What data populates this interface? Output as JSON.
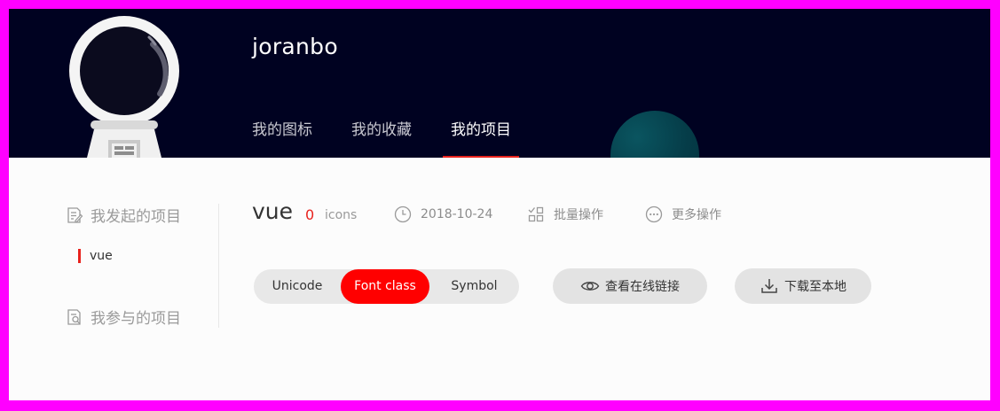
{
  "header": {
    "username": "joranbo",
    "tabs": [
      {
        "label": "我的图标",
        "active": false
      },
      {
        "label": "我的收藏",
        "active": false
      },
      {
        "label": "我的项目",
        "active": true
      }
    ]
  },
  "sidebar": {
    "groups": [
      {
        "label": "我发起的项目",
        "icon": "edit-document-icon"
      },
      {
        "label": "我参与的项目",
        "icon": "document-search-icon"
      }
    ],
    "active_item": "vue"
  },
  "project": {
    "name": "vue",
    "icon_count": "0",
    "icon_unit": "icons",
    "date": "2018-10-24",
    "batch_label": "批量操作",
    "more_label": "更多操作"
  },
  "toolbar": {
    "segments": [
      {
        "label": "Unicode",
        "active": false
      },
      {
        "label": "Font class",
        "active": true
      },
      {
        "label": "Symbol",
        "active": false
      }
    ],
    "view_link_label": "查看在线链接",
    "download_label": "下载至本地"
  },
  "colors": {
    "header_bg": "#000221",
    "accent_red": "#ff0000",
    "frame_border": "#ff00ff"
  }
}
